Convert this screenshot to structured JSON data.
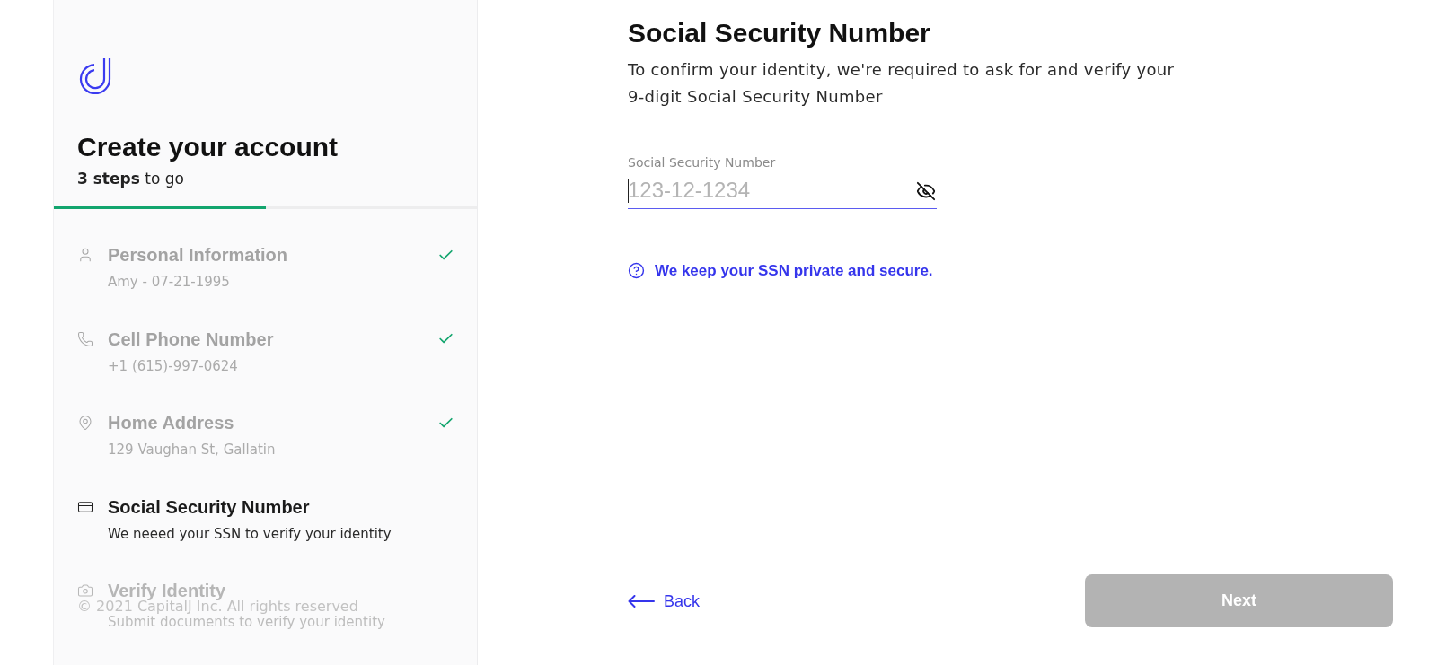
{
  "sidebar": {
    "title": "Create your account",
    "steps_remaining": "**3 steps** to go",
    "progress": {
      "level": 0.5
    },
    "steps": [
      {
        "title": "Personal Information",
        "subtitle": "Amy - 07-21-1995",
        "completed": true,
        "selected": false
      },
      {
        "title": "Cell Phone Number",
        "subtitle": "+1 (615)-997-0624",
        "completed": true,
        "selected": false
      },
      {
        "title": "Home Address",
        "subtitle": "129 Vaughan St, Gallatin",
        "completed": true,
        "selected": false
      },
      {
        "title": "Social Security Number",
        "subtitle": "We neeed your SSN to verify your identity",
        "completed": false,
        "selected": true
      },
      {
        "title": "Verify Identity",
        "subtitle": "Submit documents to verify your identity",
        "completed": false,
        "selected": false
      }
    ],
    "footer": "© 2021 CapitalJ Inc. All rights reserved"
  },
  "main": {
    "title": "Social Security Number",
    "description": "To confirm your identity, we're required to ask for and verify your 9-digit Social Security Number",
    "field": {
      "label": "Social Security Number",
      "placeholder": "123-12-1234",
      "focused": true
    },
    "help_link": "We keep your SSN private and secure.",
    "back": "Back",
    "next": {
      "label": "Next",
      "disabled": true
    }
  }
}
